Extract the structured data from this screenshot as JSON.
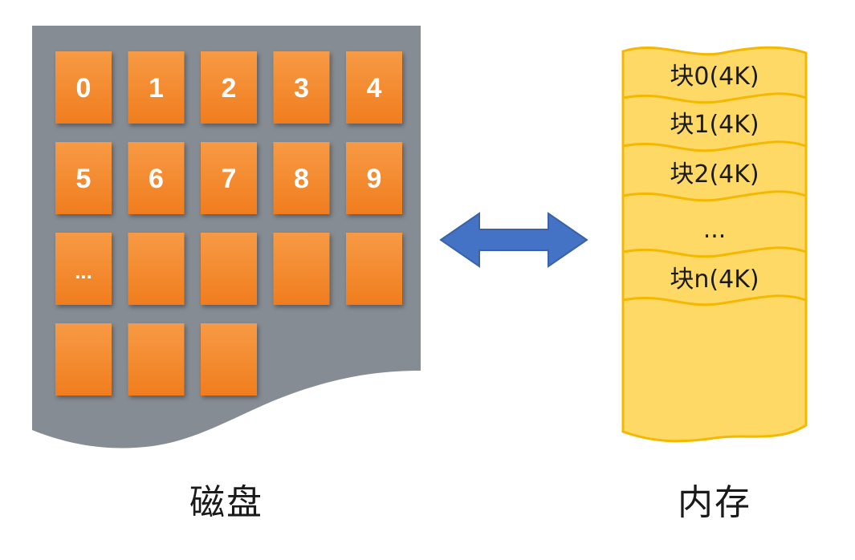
{
  "disk": {
    "label": "磁盘",
    "colors": {
      "panel": "#868c93",
      "block": "#f07d1e",
      "block_top": "#f79a45",
      "block_text": "#ffffff"
    },
    "rows": [
      [
        "0",
        "1",
        "2",
        "3",
        "4"
      ],
      [
        "5",
        "6",
        "7",
        "8",
        "9"
      ],
      [
        "...",
        "",
        "",
        "",
        ""
      ],
      [
        "",
        "",
        ""
      ]
    ]
  },
  "arrow": {
    "color": "#4472c4",
    "stroke": "#3a62a8"
  },
  "memory": {
    "label": "内存",
    "colors": {
      "fill": "#ffd966",
      "border": "#f5b800",
      "text": "#1a1a1a"
    },
    "blocks": [
      "块0(4K)",
      "块1(4K)",
      "块2(4K)",
      "...",
      "块n(4K)"
    ]
  }
}
